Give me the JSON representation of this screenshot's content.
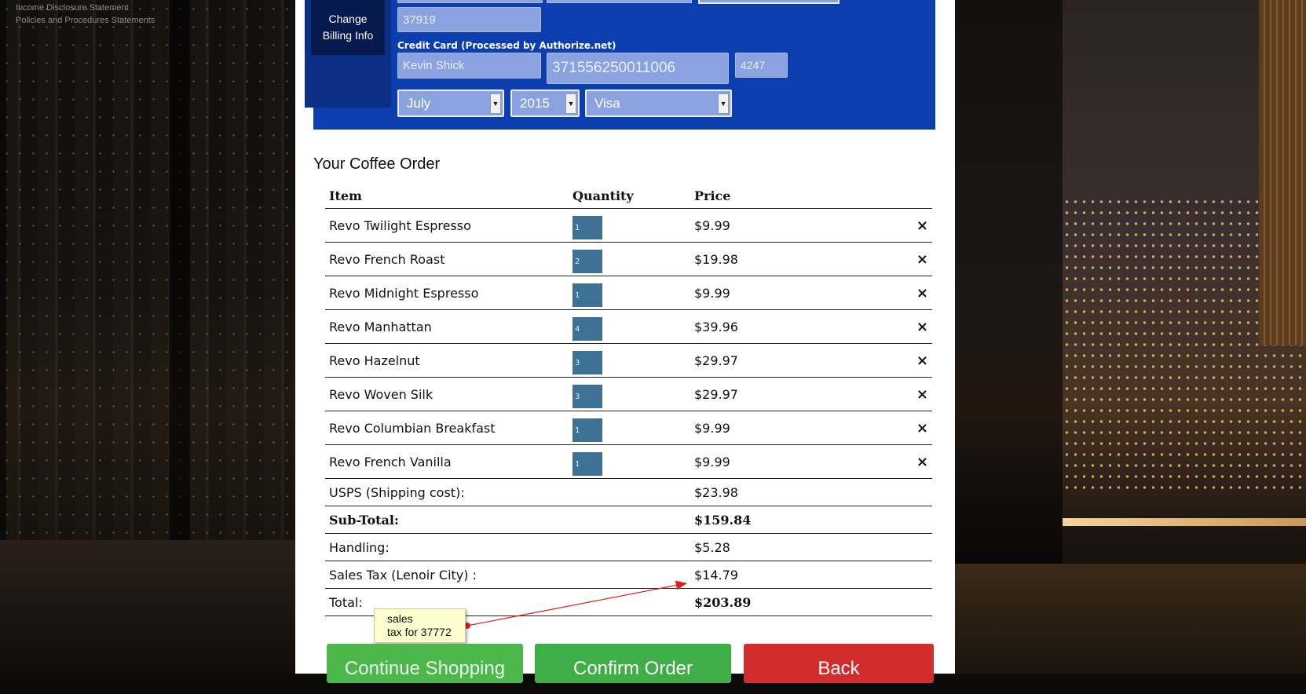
{
  "footer": {
    "links": [
      "Income Disclosure Statement",
      "Policies and Procedures Statements"
    ]
  },
  "billing": {
    "change_button": "Change Billing Info",
    "zip": "37919",
    "credit_card_label": "Credit Card (Processed by Authorize.net)",
    "cardholder": "Kevin Shick",
    "card_number": "371556250011006",
    "cvv": "4247",
    "exp_month": "July",
    "exp_year": "2015",
    "card_type": "Visa"
  },
  "order": {
    "title": "Your Coffee Order",
    "columns": [
      "Item",
      "Quantity",
      "Price"
    ],
    "items": [
      {
        "name": "Revo Twilight Espresso",
        "qty": "1",
        "price": "$9.99"
      },
      {
        "name": "Revo French Roast",
        "qty": "2",
        "price": "$19.98"
      },
      {
        "name": "Revo Midnight Espresso",
        "qty": "1",
        "price": "$9.99"
      },
      {
        "name": "Revo Manhattan",
        "qty": "4",
        "price": "$39.96"
      },
      {
        "name": "Revo Hazelnut",
        "qty": "3",
        "price": "$29.97"
      },
      {
        "name": "Revo Woven Silk",
        "qty": "3",
        "price": "$29.97"
      },
      {
        "name": "Revo Columbian Breakfast",
        "qty": "1",
        "price": "$9.99"
      },
      {
        "name": "Revo French Vanilla",
        "qty": "1",
        "price": "$9.99"
      }
    ],
    "remove_icon": "×",
    "summary": [
      {
        "label": "USPS (Shipping cost):",
        "value": "$23.98",
        "bold": false
      },
      {
        "label": "Sub-Total:",
        "value": "$159.84",
        "bold": true
      },
      {
        "label": "Handling:",
        "value": "$5.28",
        "bold": false
      },
      {
        "label": "Sales Tax (Lenoir City) :",
        "value": "$14.79",
        "bold": false
      },
      {
        "label": "Total:",
        "value": "$203.89",
        "bold": true
      }
    ]
  },
  "annotation": {
    "line1": "sales",
    "line2": "tax for 37772",
    "color": "#e02020"
  },
  "buttons": {
    "continue": "Continue Shopping",
    "confirm": "Confirm Order",
    "back": "Back"
  },
  "colors": {
    "billing_panel": "#0d3eb0",
    "quantity_box": "#3d7296",
    "continue": "#4cb84c",
    "confirm": "#3fae47",
    "back": "#d22c2c"
  }
}
